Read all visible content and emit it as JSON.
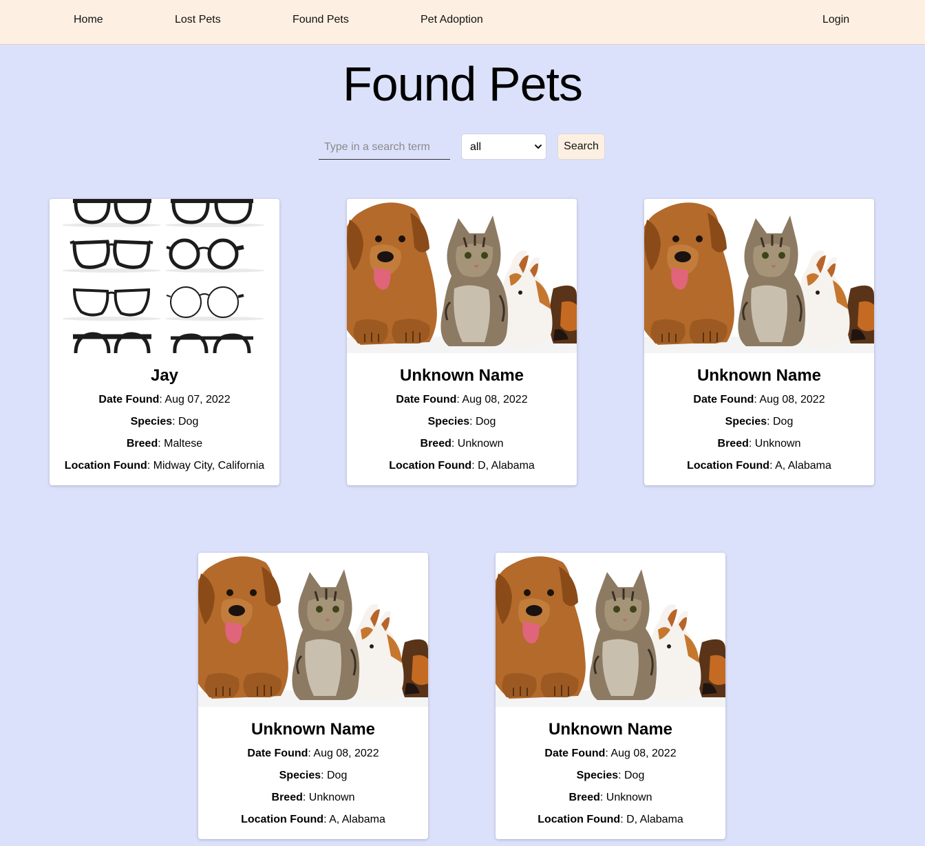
{
  "nav": {
    "home": "Home",
    "lost_pets": "Lost Pets",
    "found_pets": "Found Pets",
    "pet_adoption": "Pet Adoption",
    "login": "Login"
  },
  "page": {
    "title": "Found Pets"
  },
  "search": {
    "placeholder": "Type in a search term",
    "value": "",
    "species_selected": "all",
    "button_label": "Search"
  },
  "labels": {
    "date_found": "Date Found",
    "species": "Species",
    "breed": "Breed",
    "location_found": "Location Found"
  },
  "pets": [
    {
      "name": "Jay",
      "date_found": "Aug 07, 2022",
      "species": "Dog",
      "breed": "Maltese",
      "location": "Midway City, California",
      "image": "glasses-photo"
    },
    {
      "name": "Unknown Name",
      "date_found": "Aug 08, 2022",
      "species": "Dog",
      "breed": "Unknown",
      "location": "D, Alabama",
      "image": "pets-group-photo"
    },
    {
      "name": "Unknown Name",
      "date_found": "Aug 08, 2022",
      "species": "Dog",
      "breed": "Unknown",
      "location": "A, Alabama",
      "image": "pets-group-photo"
    },
    {
      "name": "Unknown Name",
      "date_found": "Aug 08, 2022",
      "species": "Dog",
      "breed": "Unknown",
      "location": "A, Alabama",
      "image": "pets-group-photo"
    },
    {
      "name": "Unknown Name",
      "date_found": "Aug 08, 2022",
      "species": "Dog",
      "breed": "Unknown",
      "location": "D, Alabama",
      "image": "pets-group-photo"
    }
  ],
  "colors": {
    "page_background": "#dce1fb",
    "navbar_background": "#fdf0e2",
    "card_background": "#ffffff"
  }
}
